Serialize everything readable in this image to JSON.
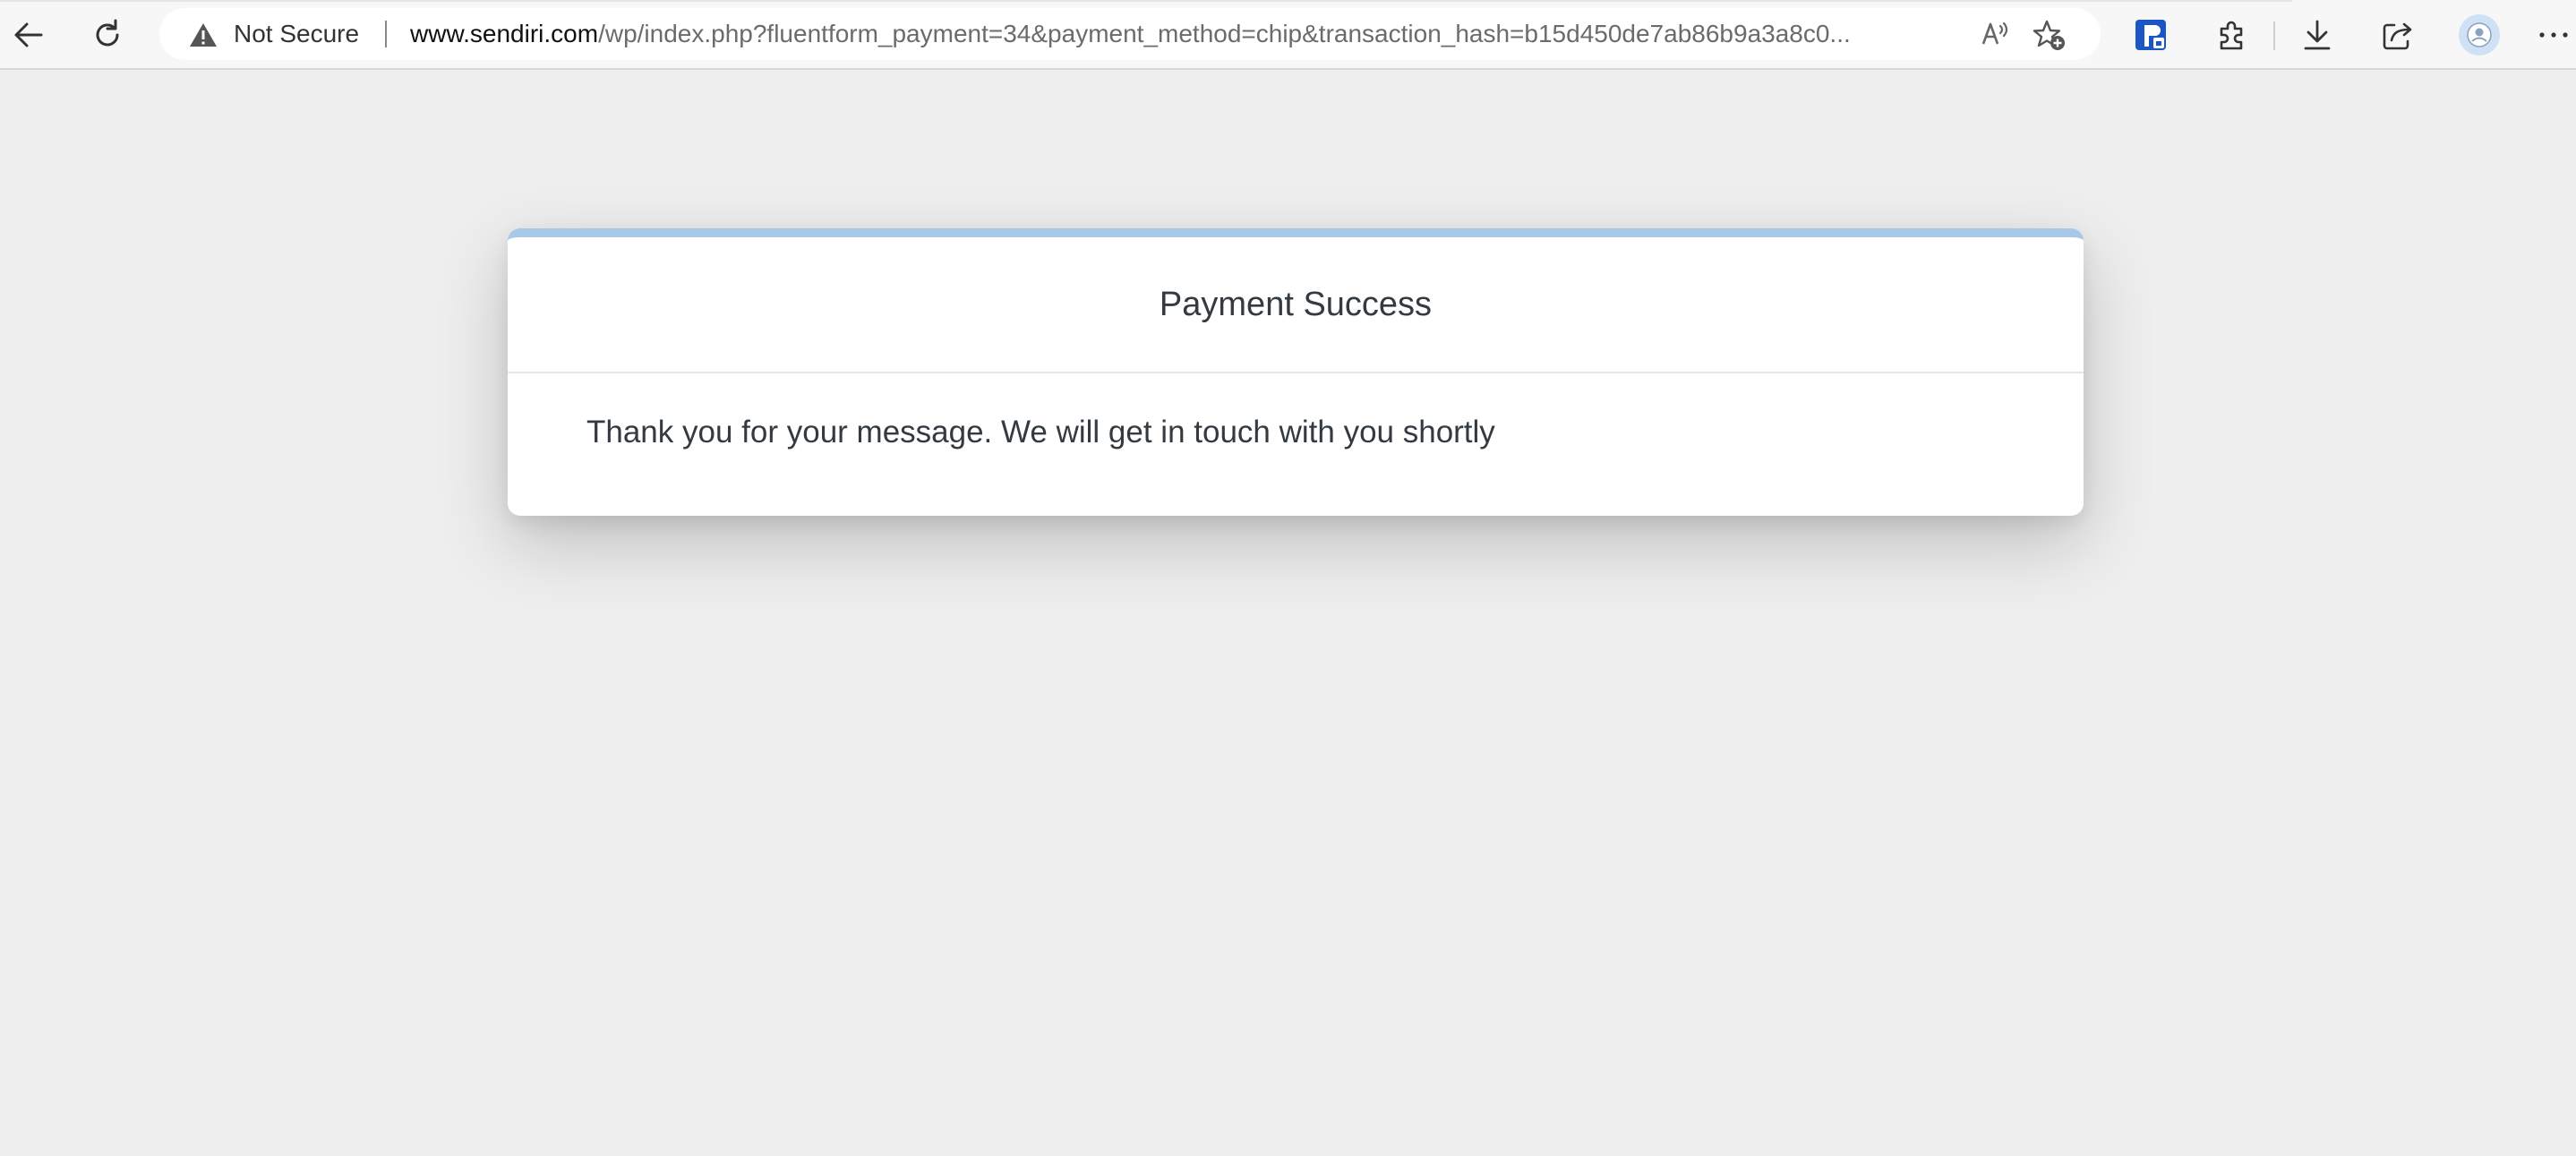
{
  "browser": {
    "security_label": "Not Secure",
    "url_host": "www.sendiri.com",
    "url_path": "/wp/index.php?fluentform_payment=34&payment_method=chip&transaction_hash=b15d450de7ab86b9a3a8c0...",
    "icons": {
      "back": "back-arrow-icon",
      "reload": "reload-icon",
      "warning": "warning-triangle-icon",
      "read_aloud": "read-aloud-icon",
      "favorite": "add-favorite-icon",
      "extension_badge": "extension-badge-icon",
      "extensions": "extensions-puzzle-icon",
      "downloads": "download-icon",
      "share": "share-icon",
      "profile": "profile-avatar-icon",
      "menu": "more-menu-icon"
    }
  },
  "page": {
    "title": "Payment Success",
    "message": "Thank you for your message. We will get in touch with you shortly"
  },
  "colors": {
    "page_background": "#eeeeee",
    "card_accent": "#a8c8e8",
    "text": "#333a40"
  }
}
